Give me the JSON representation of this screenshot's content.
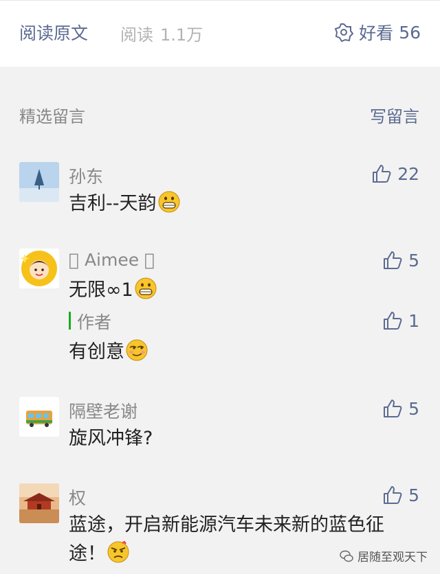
{
  "topbar": {
    "read_original": "阅读原文",
    "read_label": "阅读",
    "read_count": "1.1万",
    "wow_label": "好看",
    "wow_count": "56"
  },
  "section": {
    "title": "精选留言",
    "write_label": "写留言"
  },
  "comments": [
    {
      "nick": "孙东",
      "text": "吉利--天韵",
      "likes": "22",
      "emoji": "grin"
    },
    {
      "nick": "􏰀 Aimee 􏰀",
      "text": "无限∞1",
      "likes": "5",
      "emoji": "grin",
      "reply": {
        "author": "作者",
        "text": "有创意",
        "likes": "1",
        "emoji": "smirk"
      }
    },
    {
      "nick": "隔壁老谢",
      "text": "旋风冲锋?",
      "likes": "5"
    },
    {
      "nick": "权",
      "text_line1": "蓝途，开启新能源汽车未来新的蓝色征",
      "text_line2": "途！",
      "likes": "5",
      "emoji": "angry"
    }
  ],
  "watermark": {
    "text": "居随至观天下"
  },
  "colors": {
    "link": "#5b6a91",
    "author_bar": "#1aad19",
    "muted": "#888888"
  }
}
